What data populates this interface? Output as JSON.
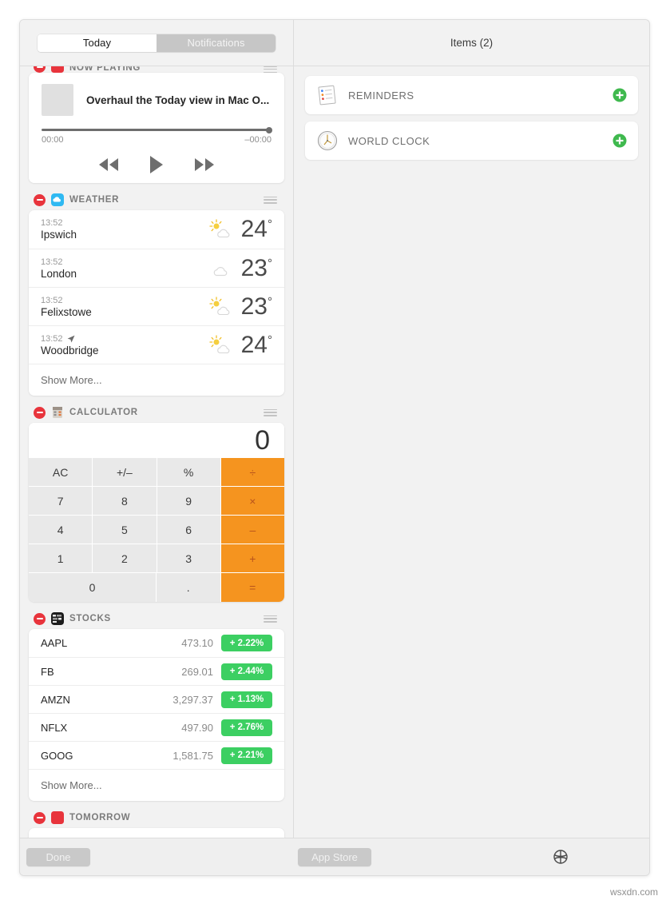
{
  "window": {
    "tabs": {
      "today": "Today",
      "notifications": "Notifications",
      "selected": "Today"
    },
    "right_header": "Items (2)"
  },
  "widgets": [
    {
      "id": "now-playing",
      "title": "NOW PLAYING",
      "icon": "now-playing-icon",
      "track_title": "Overhaul the Today view in Mac O...",
      "elapsed": "00:00",
      "remaining": "–00:00",
      "progress_percent": 100,
      "controls": [
        "rewind",
        "play",
        "fast-forward"
      ]
    },
    {
      "id": "weather",
      "title": "WEATHER",
      "icon": "weather-icon",
      "accent": "#2fb9f2",
      "rows": [
        {
          "time": "13:52",
          "city": "Ipswich",
          "icon": "sun-behind-cloud-icon",
          "temp": "24",
          "unit": "°",
          "location_arrow": false
        },
        {
          "time": "13:52",
          "city": "London",
          "icon": "cloud-icon",
          "temp": "23",
          "unit": "°",
          "location_arrow": false
        },
        {
          "time": "13:52",
          "city": "Felixstowe",
          "icon": "sun-behind-cloud-icon",
          "temp": "23",
          "unit": "°",
          "location_arrow": false
        },
        {
          "time": "13:52",
          "city": "Woodbridge",
          "icon": "sun-behind-cloud-icon",
          "temp": "24",
          "unit": "°",
          "location_arrow": true
        }
      ],
      "show_more": "Show More..."
    },
    {
      "id": "calculator",
      "title": "CALCULATOR",
      "icon": "calculator-icon",
      "display": "0",
      "op_color": "#f5941f",
      "keys": [
        [
          {
            "label": "AC",
            "type": "fn"
          },
          {
            "label": "+/–",
            "type": "fn"
          },
          {
            "label": "%",
            "type": "fn"
          },
          {
            "label": "÷",
            "type": "op"
          }
        ],
        [
          {
            "label": "7",
            "type": "num"
          },
          {
            "label": "8",
            "type": "num"
          },
          {
            "label": "9",
            "type": "num"
          },
          {
            "label": "×",
            "type": "op"
          }
        ],
        [
          {
            "label": "4",
            "type": "num"
          },
          {
            "label": "5",
            "type": "num"
          },
          {
            "label": "6",
            "type": "num"
          },
          {
            "label": "–",
            "type": "op"
          }
        ],
        [
          {
            "label": "1",
            "type": "num"
          },
          {
            "label": "2",
            "type": "num"
          },
          {
            "label": "3",
            "type": "num"
          },
          {
            "label": "+",
            "type": "op"
          }
        ],
        [
          {
            "label": "0",
            "type": "num-wide"
          },
          {
            "label": ".",
            "type": "num"
          },
          {
            "label": "=",
            "type": "op"
          }
        ]
      ]
    },
    {
      "id": "stocks",
      "title": "STOCKS",
      "icon": "stocks-icon",
      "badge_color": "#3ccf62",
      "rows": [
        {
          "symbol": "AAPL",
          "price": "473.10",
          "change": "+ 2.22%"
        },
        {
          "symbol": "FB",
          "price": "269.01",
          "change": "+ 2.44%"
        },
        {
          "symbol": "AMZN",
          "price": "3,297.37",
          "change": "+ 1.13%"
        },
        {
          "symbol": "NFLX",
          "price": "497.90",
          "change": "+ 2.76%"
        },
        {
          "symbol": "GOOG",
          "price": "1,581.75",
          "change": "+ 2.21%"
        }
      ],
      "show_more": "Show More..."
    },
    {
      "id": "tomorrow",
      "title": "TOMORROW",
      "icon": "tomorrow-icon"
    }
  ],
  "gallery": {
    "items": [
      {
        "label": "REMINDERS",
        "icon": "reminders-icon",
        "add": "add-icon"
      },
      {
        "label": "WORLD CLOCK",
        "icon": "world-clock-icon",
        "add": "add-icon"
      }
    ]
  },
  "toolbar": {
    "done_label": "Done",
    "app_store_label": "App Store",
    "settings_icon": "gear-icon"
  },
  "watermark": "wsxdn.com"
}
